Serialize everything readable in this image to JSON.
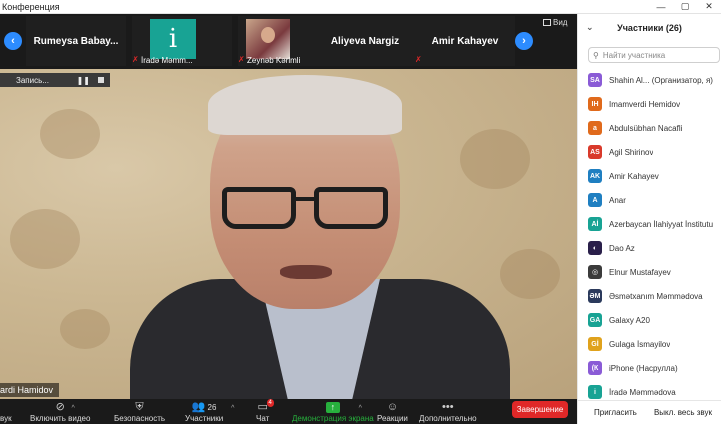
{
  "window": {
    "title": "Конференция",
    "controls": [
      "—",
      "▢",
      "✕"
    ]
  },
  "strip": {
    "view_label": "Вид",
    "thumbnails": [
      {
        "name": "Rumeysa  Babay..."
      },
      {
        "tile_letter": "i",
        "bottom_label": "İradə Məmm..."
      },
      {
        "bottom_label": "Zeynəb Kərimli"
      },
      {
        "name": "Aliyeva Nargiz"
      },
      {
        "name": "Amir Kahayev"
      }
    ]
  },
  "video": {
    "record_label": "Запись...",
    "speaker_name": "ardi Hamidov"
  },
  "toolbar": {
    "audio_label": "вук",
    "video_label": "Включить видео",
    "security_label": "Безопасность",
    "participants_label": "Участники",
    "participants_count": "26",
    "chat_label": "Чат",
    "chat_badge": "4",
    "share_label": "Демонстрация экрана",
    "reactions_label": "Реакции",
    "more_label": "Дополнительно",
    "end_label": "Завершение"
  },
  "panel": {
    "title": "Участники  (26)",
    "search_placeholder": "Найти участника",
    "participants": [
      {
        "initials": "SA",
        "name": "Shahin Al...  (Организатор, я)",
        "color": "#8a5bd6"
      },
      {
        "initials": "IH",
        "name": "Imamverdi Hemidov",
        "color": "#e06a1c"
      },
      {
        "initials": "a",
        "name": "Abdulsübhan Nacafli",
        "color": "#e06a1c"
      },
      {
        "initials": "AS",
        "name": "Agil Shirinov",
        "color": "#d93a2b"
      },
      {
        "initials": "AK",
        "name": "Amir Kahayev",
        "color": "#1f7fc1"
      },
      {
        "initials": "A",
        "name": "Anar",
        "color": "#1f7fc1"
      },
      {
        "initials": "Aİ",
        "name": "Azerbaycan İlahiyyat İnstitutu",
        "color": "#18a394"
      },
      {
        "initials": "◐",
        "name": "Dao Az",
        "color": "#2a1f4a"
      },
      {
        "initials": "◎",
        "name": "Elnur Mustafayev",
        "color": "#3b3b3b"
      },
      {
        "initials": "ƏM",
        "name": "Əsmətxanım Məmmədova",
        "color": "#2b3a5c"
      },
      {
        "initials": "GA",
        "name": "Galaxy A20",
        "color": "#18a394"
      },
      {
        "initials": "Gİ",
        "name": "Gulaga İsmayilov",
        "color": "#e0a21c"
      },
      {
        "initials": "(К",
        "name": "iPhone (Насрулла)",
        "color": "#8a5bd6"
      },
      {
        "initials": "i",
        "name": "İradə Məmmədova",
        "color": "#18a394"
      }
    ],
    "invite_label": "Пригласить",
    "mute_all_label": "Выкл. весь звук"
  }
}
